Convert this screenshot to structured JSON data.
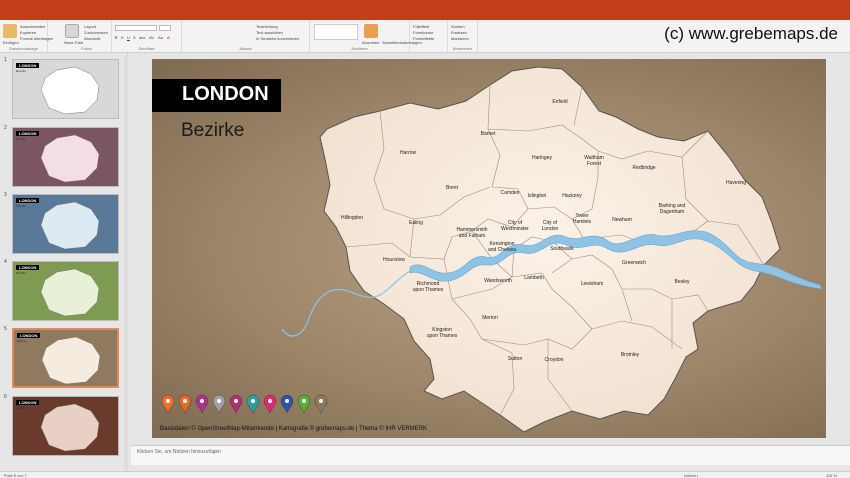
{
  "titlebar": {
    "color": "#c43e1c"
  },
  "watermark": "(c) www.grebemaps.de",
  "ribbon": {
    "groups": [
      {
        "label": "Zwischenablage",
        "items": [
          "Einfügen",
          "Ausschneiden",
          "Kopieren",
          "Format übertragen"
        ]
      },
      {
        "label": "Folien",
        "items": [
          "Neue Folie",
          "Layout",
          "Zurücksetzen",
          "Abschnitt"
        ]
      },
      {
        "label": "Schriftart",
        "items": [
          "F",
          "K",
          "U",
          "S",
          "abc",
          "AV",
          "Aa",
          "A"
        ]
      },
      {
        "label": "Absatz",
        "items": [
          "Textrichtung",
          "Text ausrichten",
          "In SmartArt konvertieren"
        ]
      },
      {
        "label": "Zeichnen",
        "items": [
          "Anordnen",
          "Schnellformatvorlagen"
        ]
      },
      {
        "label": "",
        "items": [
          "Fülleffekt",
          "Formkontur",
          "Formeffekte"
        ]
      },
      {
        "label": "Bearbeiten",
        "items": [
          "Suchen",
          "Ersetzen",
          "Markieren"
        ]
      }
    ]
  },
  "slides": {
    "thumbs": [
      {
        "num": "1",
        "bg": "#d8d8d8",
        "map": "#ffffff",
        "title": "LONDON",
        "sub": "Bezirke"
      },
      {
        "num": "2",
        "bg": "#7c5565",
        "map": "#f3dee4",
        "title": "LONDON",
        "sub": "Bezirke"
      },
      {
        "num": "3",
        "bg": "#5a7898",
        "map": "#dde9f3",
        "title": "LONDON",
        "sub": "Bezirke"
      },
      {
        "num": "4",
        "bg": "#7f9a52",
        "map": "#e8f0d7",
        "title": "LONDON",
        "sub": "Bezirke"
      },
      {
        "num": "5",
        "bg": "#8f7a60",
        "map": "#f6ebdf",
        "title": "LONDON",
        "sub": "Bezirke"
      },
      {
        "num": "6",
        "bg": "#6a3b2c",
        "map": "#e8d0c4",
        "title": "LONDON",
        "sub": "Bezirke"
      }
    ]
  },
  "slide": {
    "title": "LONDON",
    "subtitle": "Bezirke",
    "footer": "Basisdaten © OpenStreetMap-Mitwirkende | Kartografie © grebemaps.de | Thema © IHR VERMERK",
    "map_fill": "#f6eadd",
    "river_color": "#8ec3e6",
    "boroughs": [
      {
        "name": "Enfield"
      },
      {
        "name": "Barnet"
      },
      {
        "name": "Harrow"
      },
      {
        "name": "Haringey"
      },
      {
        "name": "Waltham\nForest"
      },
      {
        "name": "Redbridge"
      },
      {
        "name": "Havering"
      },
      {
        "name": "Brent"
      },
      {
        "name": "Camden"
      },
      {
        "name": "Islington"
      },
      {
        "name": "Hackney"
      },
      {
        "name": "Hillingdon"
      },
      {
        "name": "Ealing"
      },
      {
        "name": "City of\nWestminster"
      },
      {
        "name": "City of\nLondon"
      },
      {
        "name": "Tower\nHamlets"
      },
      {
        "name": "Newham"
      },
      {
        "name": "Barking and\nDagenham"
      },
      {
        "name": "Hammersmith\nand Fulham"
      },
      {
        "name": "Kensington\nand Chelsea"
      },
      {
        "name": "Southwark"
      },
      {
        "name": "Hounslow"
      },
      {
        "name": "Greenwich"
      },
      {
        "name": "Richmond\nupon Thames"
      },
      {
        "name": "Wandsworth"
      },
      {
        "name": "Lambeth"
      },
      {
        "name": "Lewisham"
      },
      {
        "name": "Bexley"
      },
      {
        "name": "Merton"
      },
      {
        "name": "Kingston\nupon Thames"
      },
      {
        "name": "Sutton"
      },
      {
        "name": "Croydon"
      },
      {
        "name": "Bromley"
      }
    ],
    "pins": [
      "#e8702a",
      "#e86a2a",
      "#b0308c",
      "#a0a0a0",
      "#b03070",
      "#2aa0a8",
      "#e02a70",
      "#3050b0",
      "#58b030",
      "#8a7a60"
    ]
  },
  "notes": {
    "placeholder": "Klicken Sie, um Notizen hinzuzufügen"
  },
  "status": {
    "slide": "Folie 5 von 7",
    "notes": "Notizen",
    "zoom": "115 %"
  }
}
